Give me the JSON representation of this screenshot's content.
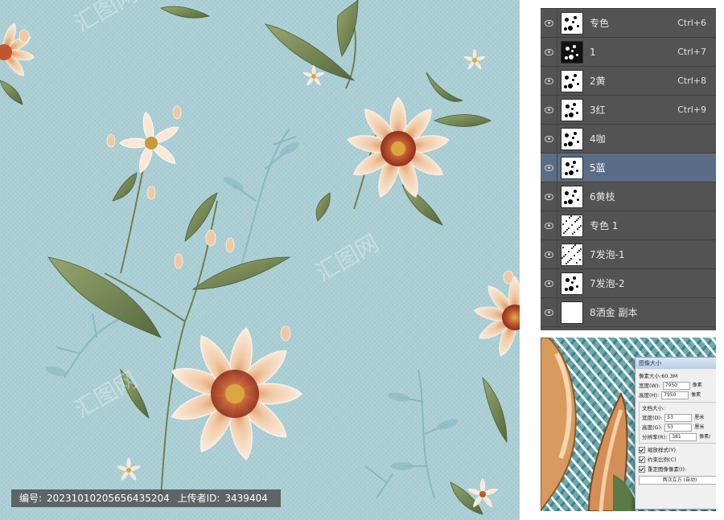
{
  "watermark": {
    "info_label_id": "编号:",
    "info_id": "20231010205656435204",
    "info_label_uploader": "上传者ID:",
    "info_uploader": "3439404"
  },
  "layers_panel": {
    "layers": [
      {
        "name": "专色",
        "shortcut": "Ctrl+6",
        "selected": false,
        "thumb": "light"
      },
      {
        "name": "1",
        "shortcut": "Ctrl+7",
        "selected": false,
        "thumb": "dark"
      },
      {
        "name": "2黄",
        "shortcut": "Ctrl+8",
        "selected": false,
        "thumb": "light"
      },
      {
        "name": "3红",
        "shortcut": "Ctrl+9",
        "selected": false,
        "thumb": "light"
      },
      {
        "name": "4咖",
        "shortcut": "",
        "selected": false,
        "thumb": "light"
      },
      {
        "name": "5蓝",
        "shortcut": "",
        "selected": true,
        "thumb": "light"
      },
      {
        "name": "6黄枝",
        "shortcut": "",
        "selected": false,
        "thumb": "light"
      },
      {
        "name": "专色 1",
        "shortcut": "",
        "selected": false,
        "thumb": "noise"
      },
      {
        "name": "7发泡-1",
        "shortcut": "",
        "selected": false,
        "thumb": "noise"
      },
      {
        "name": "7发泡-2",
        "shortcut": "",
        "selected": false,
        "thumb": "light"
      },
      {
        "name": "8洒金 副本",
        "shortcut": "",
        "selected": false,
        "thumb": "blank"
      }
    ]
  },
  "image_size_dialog": {
    "title": "图像大小",
    "pixel_dims_label": "像素大小:60.3M",
    "width_label": "宽度(W):",
    "width_value": "7950",
    "width_unit": "像素",
    "height_label": "高度(H):",
    "height_value": "7950",
    "height_unit": "像素",
    "doc_size_label": "文档大小:",
    "doc_width_label": "宽度(D):",
    "doc_width_value": "53",
    "doc_width_unit": "厘米",
    "doc_height_label": "高度(G):",
    "doc_height_value": "53",
    "doc_height_unit": "厘米",
    "resolution_label": "分辨率(R):",
    "resolution_value": "381",
    "resolution_unit": "像素/",
    "scale_styles": "缩放样式(Y)",
    "constrain": "约束比例(C)",
    "resample": "重定图像像素(I):",
    "resample_method": "两次立方 (自动)"
  },
  "colors": {
    "artwork_bg": "#a9ced4",
    "panel_bg": "#535353",
    "selected_row": "#5a6d86",
    "petal": "#f3d6b8",
    "petal_shade": "#e2a877",
    "center": "#b94a2a",
    "leaf": "#7c8f5a",
    "stem_blue": "#6fa3ad"
  }
}
